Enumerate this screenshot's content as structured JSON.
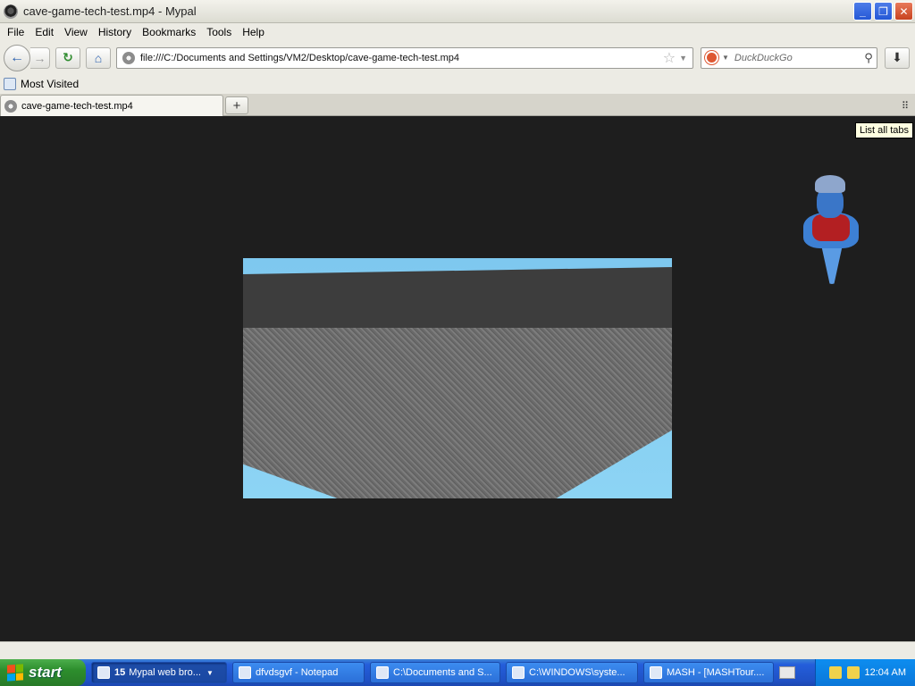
{
  "window": {
    "title": "cave-game-tech-test.mp4 - Mypal"
  },
  "menu": [
    "File",
    "Edit",
    "View",
    "History",
    "Bookmarks",
    "Tools",
    "Help"
  ],
  "nav": {
    "url": "file:///C:/Documents and Settings/VM2/Desktop/cave-game-tech-test.mp4",
    "search_placeholder": "DuckDuckGo"
  },
  "bookmarks": {
    "most_visited": "Most Visited"
  },
  "tabs": [
    {
      "label": "cave-game-tech-test.mp4"
    }
  ],
  "tooltip": "List all tabs",
  "taskbar": {
    "start_label": "start",
    "buttons": [
      {
        "count": "15",
        "label": "Mypal web bro..."
      },
      {
        "label": "dfvdsgvf - Notepad"
      },
      {
        "label": "C:\\Documents and S..."
      },
      {
        "label": "C:\\WINDOWS\\syste..."
      },
      {
        "label": "MASH - [MASHTour...."
      }
    ],
    "clock": "12:04 AM"
  }
}
